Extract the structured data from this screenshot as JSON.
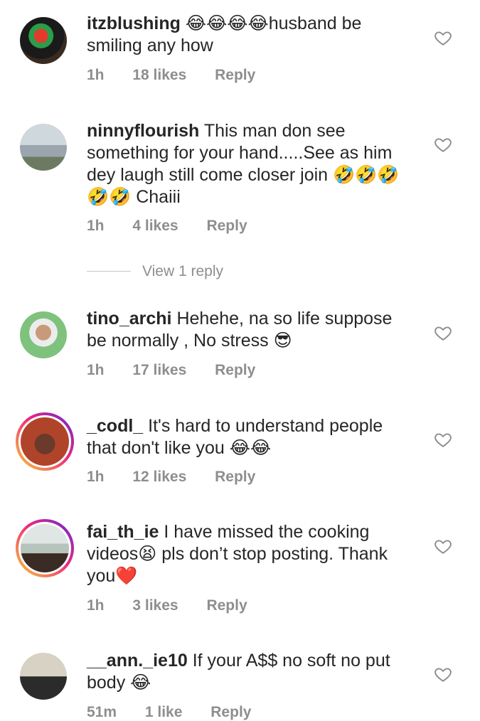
{
  "comments": [
    {
      "username": "itzblushing",
      "text_before": "",
      "text_after": "husband be smiling any how",
      "emojis_inline": "😂😂😂😂",
      "time": "1h",
      "likes": "18 likes",
      "reply": "Reply"
    },
    {
      "username": "ninnyflourish",
      "text": "This man don see something for your hand.....See as him dey laugh still come closer join",
      "emojis_end": "🤣🤣🤣🤣🤣",
      "extra": "Chaiii",
      "time": "1h",
      "likes": "4 likes",
      "reply": "Reply"
    },
    {
      "username": "tino_archi",
      "text": "Hehehe, na so life suppose be normally , No stress",
      "emojis_end": "😎",
      "time": "1h",
      "likes": "17 likes",
      "reply": "Reply"
    },
    {
      "username": "_codl_",
      "text": "It's hard to understand people that don't like you",
      "emojis_end": "😂😂",
      "time": "1h",
      "likes": "12 likes",
      "reply": "Reply"
    },
    {
      "username": "fai_th_ie",
      "text1": "I have missed the cooking videos",
      "emoji_mid": "😫",
      "text2": "pls don’t stop posting. Thank you",
      "emoji_end": "❤️",
      "time": "1h",
      "likes": "3 likes",
      "reply": "Reply"
    },
    {
      "username": "__ann._ie10",
      "text": "If your A$$ no soft no put body",
      "emojis_end": "😂",
      "time": "51m",
      "likes": "1 like",
      "reply": "Reply"
    }
  ],
  "view_reply": "View 1 reply",
  "icons": {
    "like": "heart-outline-icon"
  },
  "colors": {
    "text": "#262626",
    "meta": "#8e8e8e",
    "story_ring_start": "#f9ce34",
    "story_ring_end": "#ee2a7b"
  }
}
